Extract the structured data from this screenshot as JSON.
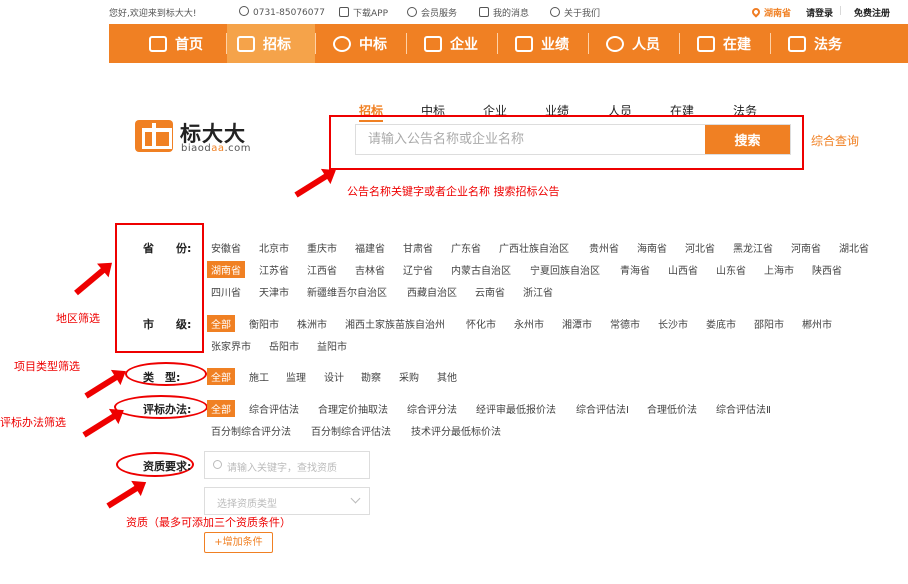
{
  "topbar": {
    "welcome": "您好,欢迎来到标大大!",
    "phone": "0731-85076077",
    "app": "下载APP",
    "member": "会员服务",
    "messages": "我的消息",
    "about": "关于我们",
    "region": "湖南省",
    "login": "请登录",
    "register": "免费注册"
  },
  "nav": [
    "首页",
    "招标",
    "中标",
    "企业",
    "业绩",
    "人员",
    "在建",
    "法务"
  ],
  "nav_active": "招标",
  "logo": {
    "brand": "标大大",
    "domain_prefix": "biaod",
    "domain_accent": "aa",
    "domain_suffix": ".com"
  },
  "search": {
    "tabs": [
      "招标",
      "中标",
      "企业",
      "业绩",
      "人员",
      "在建",
      "法务"
    ],
    "active_tab": "招标",
    "placeholder": "请输入公告名称或企业名称",
    "button": "搜索",
    "composite_link": "综合查询"
  },
  "annotations": {
    "search_hint": "公告名称关键字或者企业名称 搜索招标公告",
    "region": "地区筛选",
    "type": "项目类型筛选",
    "method": "评标办法筛选",
    "qualification": "资质（最多可添加三个资质条件）"
  },
  "filters": {
    "province_label": "省　　份:",
    "provinces": [
      "安徽省",
      "北京市",
      "重庆市",
      "福建省",
      "甘肃省",
      "广东省",
      "广西壮族自治区",
      "贵州省",
      "海南省",
      "河北省",
      "黑龙江省",
      "河南省",
      "湖北省",
      "湖南省",
      "江苏省",
      "江西省",
      "吉林省",
      "辽宁省",
      "内蒙古自治区",
      "宁夏回族自治区",
      "青海省",
      "山西省",
      "山东省",
      "上海市",
      "陕西省",
      "四川省",
      "天津市",
      "新疆维吾尔自治区",
      "西藏自治区",
      "云南省",
      "浙江省"
    ],
    "province_selected": "湖南省",
    "city_label": "市　　级:",
    "cities": [
      "全部",
      "衡阳市",
      "株洲市",
      "湘西土家族苗族自治州",
      "怀化市",
      "永州市",
      "湘潭市",
      "常德市",
      "长沙市",
      "娄底市",
      "邵阳市",
      "郴州市",
      "张家界市",
      "岳阳市",
      "益阳市"
    ],
    "city_selected": "全部",
    "type_label": "类　型:",
    "types": [
      "全部",
      "施工",
      "监理",
      "设计",
      "勘察",
      "采购",
      "其他"
    ],
    "type_selected": "全部",
    "method_label": "评标办法:",
    "methods": [
      "全部",
      "综合评估法",
      "合理定价抽取法",
      "综合评分法",
      "经评审最低报价法",
      "综合评估法Ⅰ",
      "合理低价法",
      "综合评估法Ⅱ",
      "百分制综合评分法",
      "百分制综合评估法",
      "技术评分最低标价法"
    ],
    "method_selected": "全部",
    "qualification_label": "资质要求:",
    "qualification_placeholder": "请输入关键字，查找资质",
    "qualification_type_placeholder": "选择资质类型",
    "add_condition": "+增加条件"
  },
  "colors": {
    "brand": "#f08023",
    "annotation": "#e00000"
  }
}
